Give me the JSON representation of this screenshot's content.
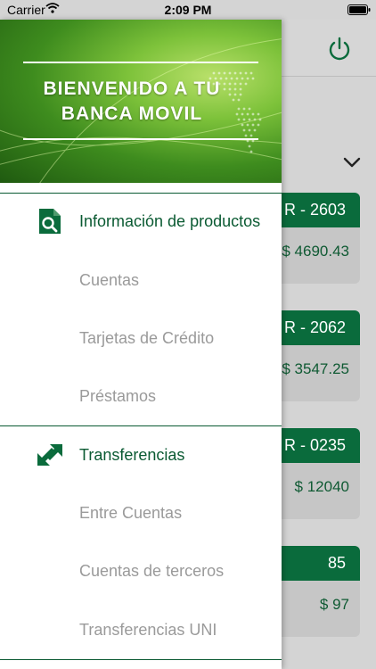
{
  "status_bar": {
    "carrier": "Carrier",
    "time": "2:09 PM"
  },
  "accounts": [
    {
      "title": "R - 2603",
      "amount": "$ 4690.43"
    },
    {
      "title": "R - 2062",
      "amount": "$ 3547.25"
    },
    {
      "title": "R - 0235",
      "amount": "$ 12040"
    },
    {
      "title": "85",
      "amount": "$ 97"
    }
  ],
  "drawer": {
    "banner_title_line1": "BIENVENIDO A TU",
    "banner_title_line2": "BANCA MOVIL",
    "sections": [
      {
        "label": "Información de productos",
        "icon": "product-search-icon",
        "items": [
          "Cuentas",
          "Tarjetas de Crédito",
          "Préstamos"
        ]
      },
      {
        "label": "Transferencias",
        "icon": "transfer-arrows-icon",
        "items": [
          "Entre Cuentas",
          "Cuentas de terceros",
          "Transferencias UNI"
        ]
      }
    ]
  },
  "colors": {
    "brand_green": "#0a6b3c",
    "muted_text": "#9a9a9a"
  }
}
